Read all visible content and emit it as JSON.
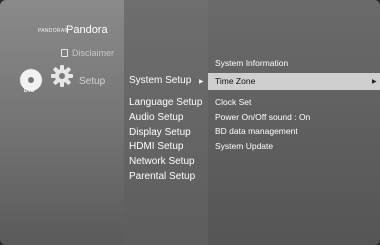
{
  "branding": {
    "pandora_small": "PANDORA®",
    "pandora": "Pandora"
  },
  "left_menu": {
    "disclaimer_label": "Disclaimer",
    "setup_label": "Setup",
    "disc_label": "DVD"
  },
  "middle_menu": {
    "active_label": "System Setup",
    "items": [
      {
        "label": "Language Setup"
      },
      {
        "label": "Audio Setup"
      },
      {
        "label": "Display Setup"
      },
      {
        "label": "HDMI Setup"
      },
      {
        "label": "Network Setup"
      },
      {
        "label": "Parental Setup"
      }
    ]
  },
  "right_menu": {
    "header": "System Information",
    "highlighted": "Time Zone",
    "items": [
      {
        "label": "Clock Set"
      },
      {
        "label": "Power On/Off sound    :  On"
      },
      {
        "label": "BD data management"
      },
      {
        "label": "System Update"
      }
    ]
  },
  "icons": {
    "page": "page-icon",
    "gear": "gear-icon",
    "disc": "disc-icon",
    "arrow": "arrow-right-icon"
  },
  "colors": {
    "highlight_bar": "#cfcfcf",
    "background": "#777777"
  }
}
